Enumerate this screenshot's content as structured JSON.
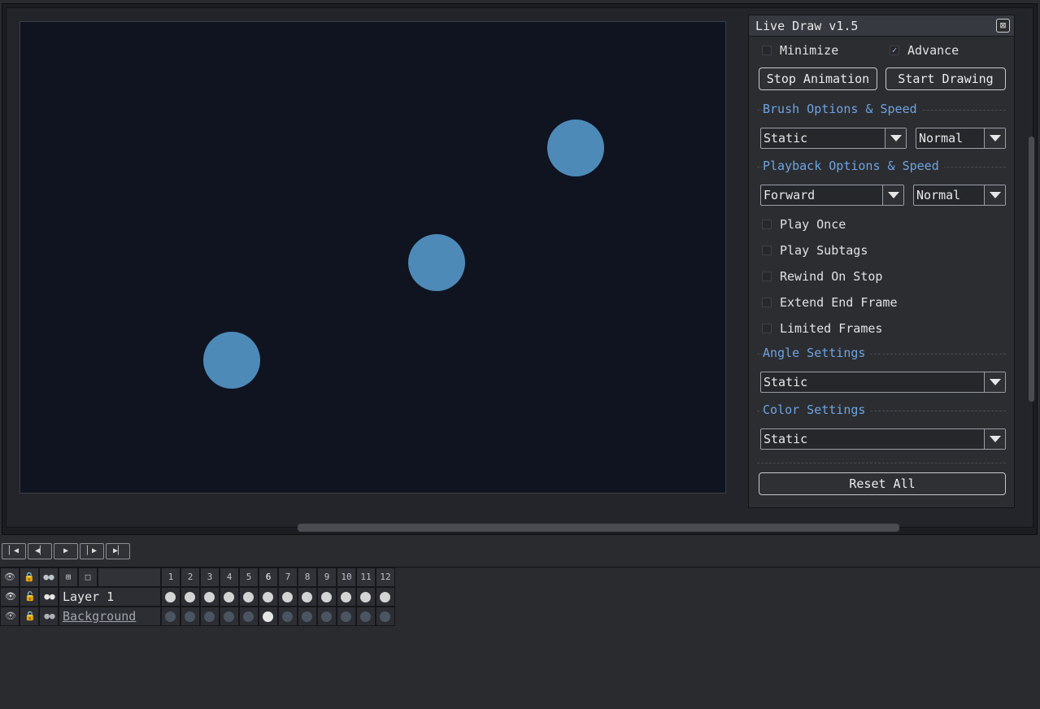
{
  "dialog": {
    "title": "Live Draw v1.5",
    "close_glyph": "⊠",
    "minimize_label": "Minimize",
    "minimize_checked": false,
    "advance_label": "Advance",
    "advance_checked": true,
    "stop_animation_label": "Stop Animation",
    "start_drawing_label": "Start Drawing",
    "brush_section": "Brush Options & Speed",
    "brush_mode": "Static",
    "brush_speed": "Normal",
    "playback_section": "Playback Options & Speed",
    "playback_mode": "Forward",
    "playback_speed": "Normal",
    "options": [
      {
        "label": "Play Once",
        "checked": false
      },
      {
        "label": "Play Subtags",
        "checked": false
      },
      {
        "label": "Rewind On Stop",
        "checked": false
      },
      {
        "label": "Extend End Frame",
        "checked": false
      },
      {
        "label": "Limited Frames",
        "checked": false
      }
    ],
    "angle_section": "Angle Settings",
    "angle_mode": "Static",
    "color_section": "Color Settings",
    "color_mode": "Static",
    "reset_label": "Reset All"
  },
  "canvas": {
    "background": "#0f1420",
    "dot_color": "#4e8ab8"
  },
  "timeline": {
    "controls": [
      "first-frame",
      "previous-frame",
      "play",
      "next-frame",
      "last-frame"
    ],
    "control_glyphs": [
      "▏◀",
      "◀▏",
      "▶",
      "▏▶",
      "▶▏"
    ],
    "frames": [
      "1",
      "2",
      "3",
      "4",
      "5",
      "6",
      "7",
      "8",
      "9",
      "10",
      "11",
      "12"
    ],
    "current_frame": "6",
    "layers": [
      {
        "name": "Layer 1",
        "underlined": false
      },
      {
        "name": "Background",
        "underlined": true
      }
    ],
    "colors": {
      "cel_filled": "#d4d4d4",
      "cel_empty": "#4a5561",
      "bg_active_cel": "#e6e6e6"
    }
  }
}
